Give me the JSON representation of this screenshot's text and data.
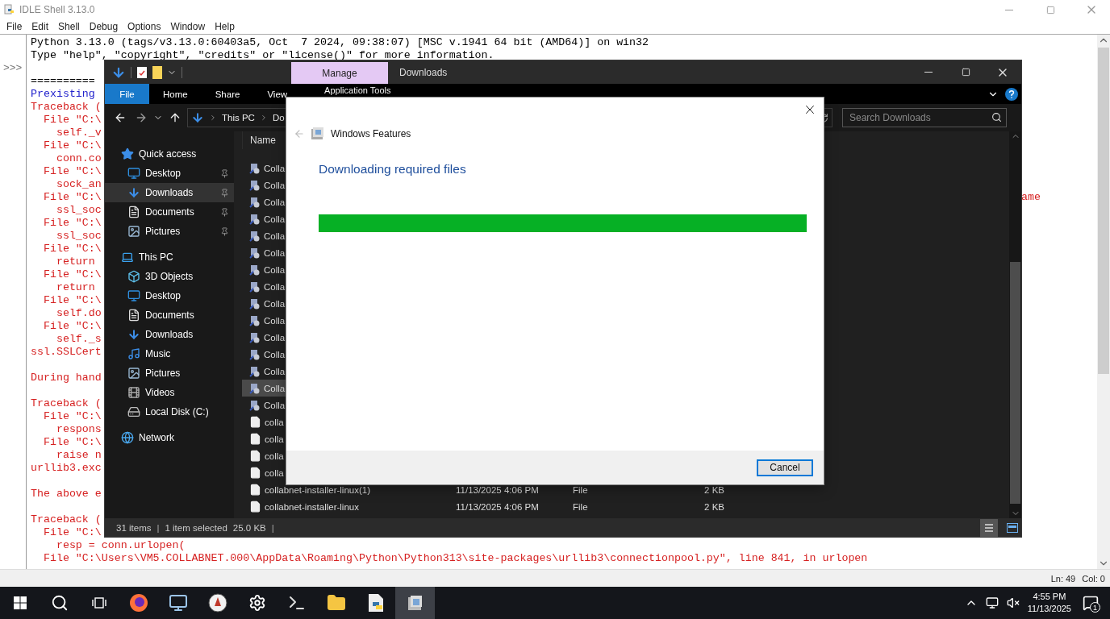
{
  "idle": {
    "title": "IDLE Shell 3.13.0",
    "menu": [
      "File",
      "Edit",
      "Shell",
      "Debug",
      "Options",
      "Window",
      "Help"
    ],
    "lines": [
      {
        "kind": "output",
        "text": "Python 3.13.0 (tags/v3.13.0:60403a5, Oct  7 2024, 09:38:07) [MSC v.1941 64 bit (AMD64)] on win32"
      },
      {
        "kind": "output",
        "text": "Type \"help\", \"copyright\", \"credits\" or \"license()\" for more information."
      },
      {
        "kind": "blank",
        "prompt": ">>>"
      },
      {
        "kind": "output",
        "text": "=========="
      },
      {
        "kind": "stdout",
        "text": "Prexisting"
      },
      {
        "kind": "stderr",
        "text": "Traceback ("
      },
      {
        "kind": "stderr",
        "text": "  File \"C:\\"
      },
      {
        "kind": "stderr",
        "text": "    self._v"
      },
      {
        "kind": "stderr",
        "text": "  File \"C:\\"
      },
      {
        "kind": "stderr",
        "text": "    conn.co"
      },
      {
        "kind": "stderr",
        "text": "  File \"C:\\"
      },
      {
        "kind": "stderr",
        "text": "    sock_an"
      },
      {
        "kind": "stderr",
        "text": "  File \"C:\\",
        "tail": "ame"
      },
      {
        "kind": "stderr",
        "text": "    ssl_soc"
      },
      {
        "kind": "stderr",
        "text": "  File \"C:\\"
      },
      {
        "kind": "stderr",
        "text": "    ssl_soc"
      },
      {
        "kind": "stderr",
        "text": "  File \"C:\\"
      },
      {
        "kind": "stderr",
        "text": "    return"
      },
      {
        "kind": "stderr",
        "text": "  File \"C:\\"
      },
      {
        "kind": "stderr",
        "text": "    return"
      },
      {
        "kind": "stderr",
        "text": "  File \"C:\\"
      },
      {
        "kind": "stderr",
        "text": "    self.do"
      },
      {
        "kind": "stderr",
        "text": "  File \"C:\\"
      },
      {
        "kind": "stderr",
        "text": "    self._s"
      },
      {
        "kind": "stderr",
        "text": "ssl.SSLCert"
      },
      {
        "kind": "blank"
      },
      {
        "kind": "stderr",
        "text": "During hand"
      },
      {
        "kind": "blank"
      },
      {
        "kind": "stderr",
        "text": "Traceback ("
      },
      {
        "kind": "stderr",
        "text": "  File \"C:\\"
      },
      {
        "kind": "stderr",
        "text": "    respons"
      },
      {
        "kind": "stderr",
        "text": "  File \"C:\\"
      },
      {
        "kind": "stderr",
        "text": "    raise n"
      },
      {
        "kind": "stderr",
        "text": "urllib3.exc"
      },
      {
        "kind": "blank"
      },
      {
        "kind": "stderr",
        "text": "The above e"
      },
      {
        "kind": "blank"
      },
      {
        "kind": "stderr",
        "text": "Traceback ("
      },
      {
        "kind": "stderr",
        "text": "  File \"C:\\"
      },
      {
        "kind": "stderr",
        "text": "    resp = conn.urlopen("
      },
      {
        "kind": "stderr",
        "text": "  File \"C:\\Users\\VM5.COLLABNET.000\\AppData\\Roaming\\Python\\Python313\\site-packages\\urllib3\\connectionpool.py\", line 841, in urlopen"
      }
    ],
    "status": {
      "line": "Ln: 49",
      "column": "Col: 0"
    }
  },
  "explorer": {
    "title": "Downloads",
    "context_tab": "Manage",
    "ribbon_tabs": [
      {
        "label": "File",
        "kind": "file"
      },
      {
        "label": "Home",
        "kind": "tab"
      },
      {
        "label": "Share",
        "kind": "tab"
      },
      {
        "label": "View",
        "kind": "tab"
      },
      {
        "label": "Application Tools",
        "kind": "contextual"
      }
    ],
    "address": [
      "This PC",
      "Do"
    ],
    "search": {
      "placeholder": "Search Downloads"
    },
    "nav": [
      {
        "label": "Quick access",
        "kind": "star",
        "selected": false,
        "children": [
          {
            "label": "Desktop",
            "kind": "desktop",
            "pinned": true,
            "selected": false
          },
          {
            "label": "Downloads",
            "kind": "downloads",
            "pinned": true,
            "selected": true
          },
          {
            "label": "Documents",
            "kind": "documents",
            "pinned": true,
            "selected": false
          },
          {
            "label": "Pictures",
            "kind": "pictures",
            "pinned": true,
            "selected": false
          }
        ]
      },
      {
        "label": "This PC",
        "kind": "pc",
        "selected": false,
        "children": [
          {
            "label": "3D Objects",
            "kind": "objects",
            "pinned": false,
            "selected": false
          },
          {
            "label": "Desktop",
            "kind": "desktop",
            "pinned": false,
            "selected": false
          },
          {
            "label": "Documents",
            "kind": "documents",
            "pinned": false,
            "selected": false
          },
          {
            "label": "Downloads",
            "kind": "downloads",
            "pinned": false,
            "selected": false
          },
          {
            "label": "Music",
            "kind": "music",
            "pinned": false,
            "selected": false
          },
          {
            "label": "Pictures",
            "kind": "pictures",
            "pinned": false,
            "selected": false
          },
          {
            "label": "Videos",
            "kind": "videos",
            "pinned": false,
            "selected": false
          },
          {
            "label": "Local Disk (C:)",
            "kind": "disk",
            "pinned": false,
            "selected": false
          }
        ]
      },
      {
        "label": "Network",
        "kind": "network",
        "selected": false
      }
    ],
    "columns": [
      "Name"
    ],
    "files": [
      {
        "name": "Colla",
        "kind": "shortcut",
        "selected": false
      },
      {
        "name": "Colla",
        "kind": "shortcut",
        "selected": false
      },
      {
        "name": "Colla",
        "kind": "shortcut",
        "selected": false
      },
      {
        "name": "Colla",
        "kind": "shortcut",
        "selected": false
      },
      {
        "name": "Colla",
        "kind": "shortcut",
        "selected": false
      },
      {
        "name": "Colla",
        "kind": "shortcut",
        "selected": false
      },
      {
        "name": "Colla",
        "kind": "shortcut",
        "selected": false
      },
      {
        "name": "Colla",
        "kind": "shortcut",
        "selected": false
      },
      {
        "name": "Colla",
        "kind": "shortcut",
        "selected": false
      },
      {
        "name": "Colla",
        "kind": "shortcut",
        "selected": false
      },
      {
        "name": "Colla",
        "kind": "shortcut",
        "selected": false
      },
      {
        "name": "Colla",
        "kind": "shortcut",
        "selected": false
      },
      {
        "name": "Colla",
        "kind": "shortcut",
        "selected": false
      },
      {
        "name": "Colla",
        "kind": "shortcut",
        "selected": true
      },
      {
        "name": "Colla",
        "kind": "shortcut",
        "selected": false
      },
      {
        "name": "colla",
        "kind": "file",
        "selected": false
      },
      {
        "name": "colla",
        "kind": "file",
        "selected": false
      },
      {
        "name": "colla",
        "kind": "file",
        "selected": false
      },
      {
        "name": "colla",
        "kind": "file",
        "selected": false
      },
      {
        "name": "collabnet-installer-linux(1)",
        "kind": "file",
        "selected": false,
        "date": "11/13/2025 4:06 PM",
        "type": "File",
        "size": "2 KB"
      },
      {
        "name": "collabnet-installer-linux",
        "kind": "file",
        "selected": false,
        "date": "11/13/2025 4:06 PM",
        "type": "File",
        "size": "2 KB"
      }
    ],
    "status": {
      "count": "31 items",
      "separator_1": "|",
      "selection": "1 item selected",
      "size": "25.0 KB",
      "separator_2": "|"
    }
  },
  "dialog": {
    "title": "Windows Features",
    "heading": "Downloading required files",
    "progress": {
      "level": 1
    },
    "button": "Cancel"
  },
  "taskbar": {
    "apps": [
      {
        "kind": "firefox",
        "active": false
      },
      {
        "kind": "remote",
        "active": false
      },
      {
        "kind": "compass",
        "active": false
      },
      {
        "kind": "settings",
        "active": false
      },
      {
        "kind": "terminal",
        "active": false
      },
      {
        "kind": "folder",
        "active": false
      },
      {
        "kind": "python",
        "active": false
      },
      {
        "kind": "features",
        "active": true
      }
    ],
    "time": "4:55 PM",
    "date": "11/13/2025",
    "notifications": "1"
  }
}
